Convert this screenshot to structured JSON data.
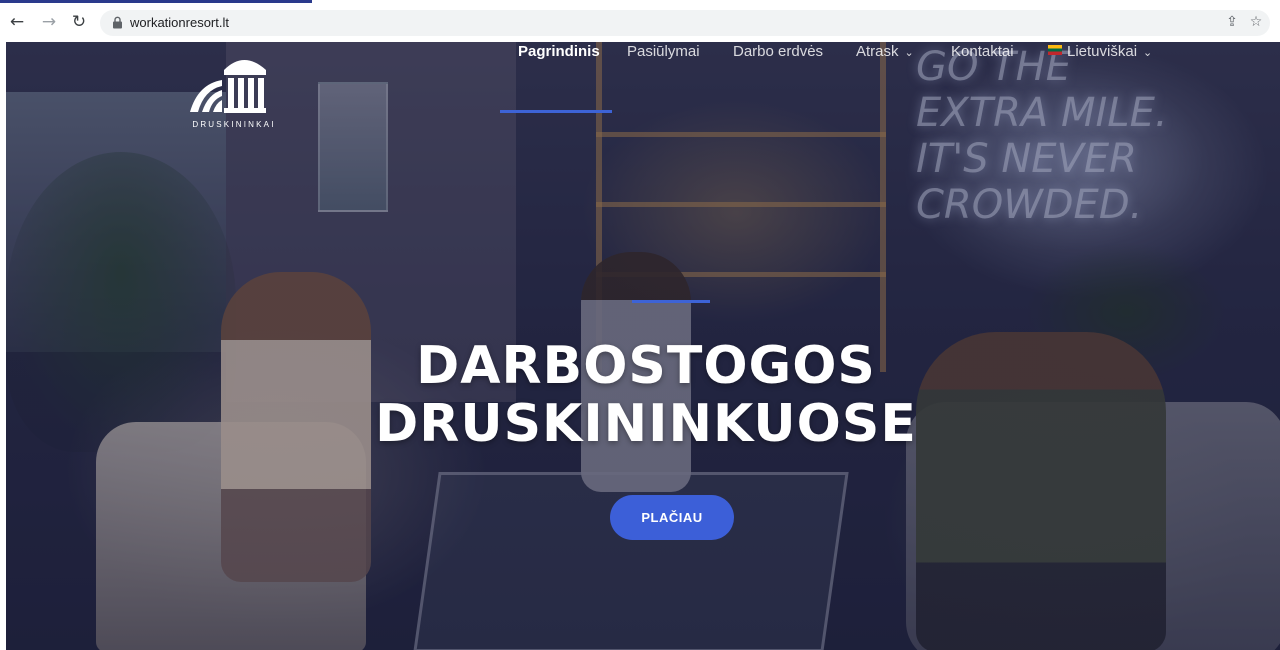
{
  "browser": {
    "url": "workationresort.lt"
  },
  "hero": {
    "neon_sign": [
      "GO THE",
      "EXTRA MILE.",
      "IT'S NEVER",
      "CROWDED."
    ],
    "title": "DARBOSTOGOS DRUSKININKUOSE",
    "cta_label": "PLAČIAU"
  },
  "logo": {
    "text": "DRUSKININKAI"
  },
  "nav": {
    "items": [
      {
        "label": "Pagrindinis",
        "active": true
      },
      {
        "label": "Pasiūlymai"
      },
      {
        "label": "Darbo erdvės"
      },
      {
        "label": "Atrask",
        "has_dropdown": true
      },
      {
        "label": "Kontaktai"
      },
      {
        "label": "Lietuviškai",
        "has_dropdown": true,
        "icon": "lithuania-flag-icon"
      }
    ]
  },
  "colors": {
    "accent": "#3c5fd8",
    "nav_underline": "#3d63d6",
    "overlay": "#14183c"
  }
}
